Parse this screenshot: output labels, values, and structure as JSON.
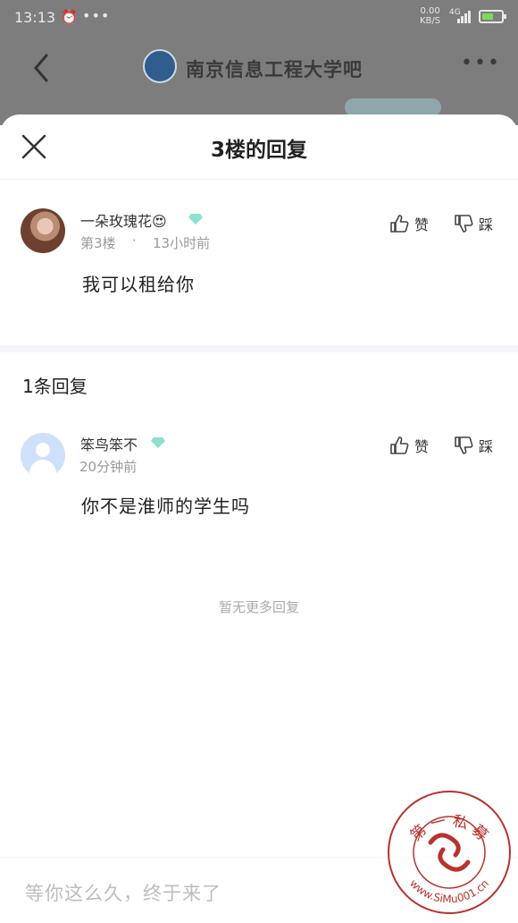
{
  "status_bar": {
    "time": "13:13",
    "dots": "•••",
    "speed_value": "0.00",
    "speed_unit": "KB/S",
    "network": "4G"
  },
  "background": {
    "forum_title": "南京信息工程大学吧"
  },
  "sheet": {
    "title": "3楼的回复"
  },
  "post": {
    "username": "一朵玫瑰花😍",
    "floor": "第3楼",
    "separator": "·",
    "time": "13小时前",
    "content": "我可以租给你",
    "like_label": "赞",
    "dislike_label": "踩"
  },
  "reply_count": "1条回复",
  "replies": [
    {
      "username": "笨鸟笨不",
      "time": "20分钟前",
      "content": "你不是淮师的学生吗",
      "like_label": "赞",
      "dislike_label": "踩"
    }
  ],
  "no_more": "暂无更多回复",
  "input": {
    "placeholder": "等你这么久，终于来了"
  },
  "watermark": {
    "top_text": "第 一 私 募",
    "bottom_text": "www.SiMu001.cn",
    "color": "#b8322e"
  },
  "colors": {
    "badge": "#8ee0cf",
    "dim_overlay": "#7d7d7d"
  }
}
